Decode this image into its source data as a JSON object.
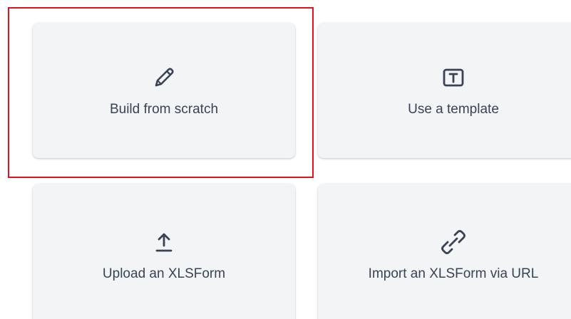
{
  "options": {
    "build": {
      "label": "Build from scratch",
      "icon": "pencil-icon"
    },
    "template": {
      "label": "Use a template",
      "icon": "template-icon"
    },
    "upload": {
      "label": "Upload an XLSForm",
      "icon": "upload-icon"
    },
    "import": {
      "label": "Import an XLSForm via URL",
      "icon": "link-icon"
    }
  },
  "colors": {
    "card_background": "#f3f4f6",
    "text": "#3a4255",
    "highlight": "#e8101a"
  }
}
